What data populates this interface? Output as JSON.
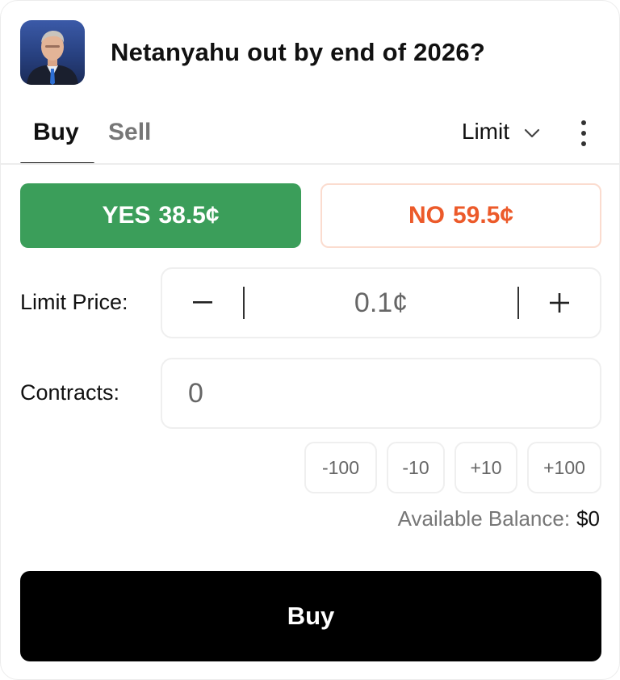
{
  "market": {
    "title": "Netanyahu out by end of 2026?",
    "avatar": "portrait-photo"
  },
  "tabs": {
    "buy": "Buy",
    "sell": "Sell",
    "active": "Buy"
  },
  "order_type": {
    "selected": "Limit",
    "icon": "chevron-down-icon"
  },
  "menu_icon": "more-vertical-icon",
  "sides": {
    "yes": {
      "label": "YES",
      "price": "38.5¢",
      "color": "#3b9e5a"
    },
    "no": {
      "label": "NO",
      "price": "59.5¢",
      "color": "#ec5a2a"
    }
  },
  "limit_price": {
    "label": "Limit Price:",
    "value": "0.1¢",
    "decrement_icon": "minus-icon",
    "increment_icon": "plus-icon"
  },
  "contracts": {
    "label": "Contracts:",
    "value": "0"
  },
  "quick_adjust": [
    "-100",
    "-10",
    "+10",
    "+100"
  ],
  "balance": {
    "label": "Available Balance:",
    "value": "$0"
  },
  "submit": {
    "label": "Buy"
  }
}
